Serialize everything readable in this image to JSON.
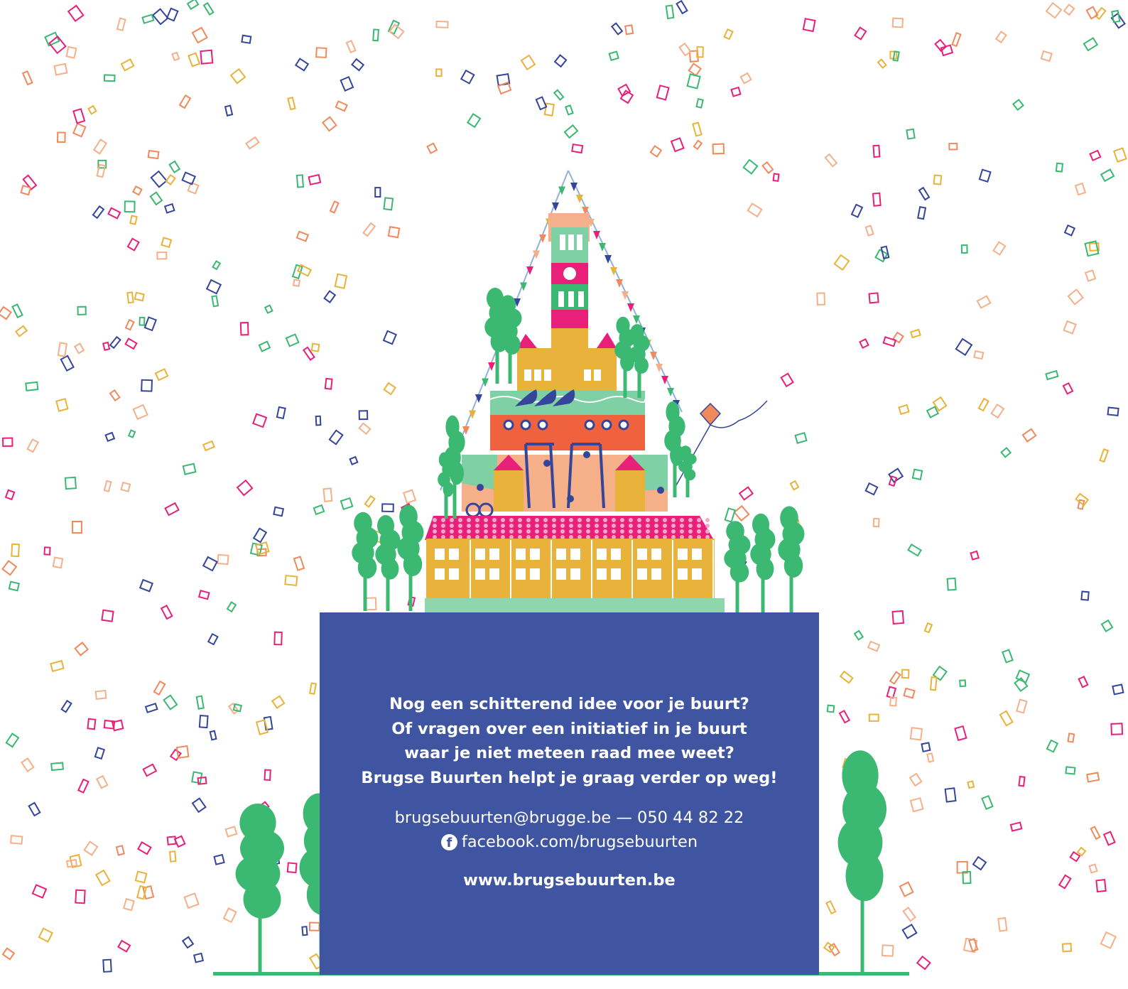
{
  "message_lines": [
    "Nog een schitterend idee voor je buurt?",
    "Of vragen over een initiatief in je buurt",
    "waar je niet meteen raad mee weet?",
    "Brugse Buurten helpt je graag verder op weg!"
  ],
  "contact": {
    "email_phone": "brugsebuurten@brugge.be — 050 44 82 22",
    "facebook_icon": "facebook-icon",
    "facebook": "facebook.com/brugsebuurten"
  },
  "website": "www.brugsebuurten.be",
  "colors": {
    "panel": "#3f55a2",
    "tree": "#3bb872",
    "confetti": [
      "#e8207a",
      "#f08a5d",
      "#3bb872",
      "#34459a",
      "#f5b08a",
      "#e9b33b"
    ]
  }
}
